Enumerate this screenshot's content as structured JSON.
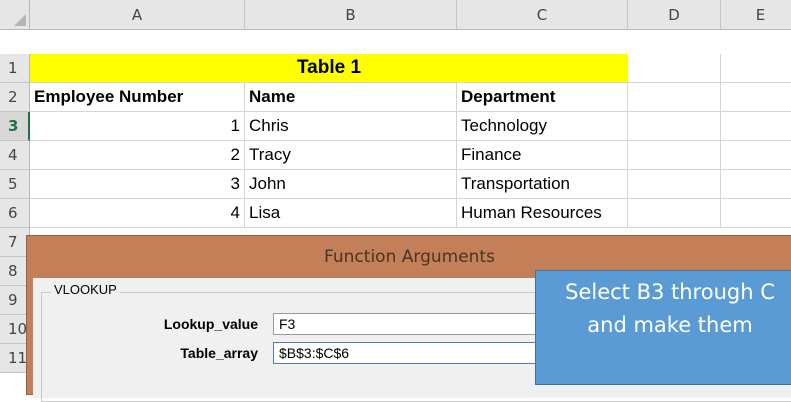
{
  "columns": [
    "A",
    "B",
    "C",
    "D",
    "E"
  ],
  "rows": [
    "1",
    "2",
    "3",
    "4",
    "5",
    "6",
    "7",
    "8",
    "9",
    "10",
    "11"
  ],
  "table_title": "Table 1",
  "headers": {
    "a": "Employee Number",
    "b": "Name",
    "c": "Department"
  },
  "records": [
    {
      "num": "1",
      "name": "Chris",
      "dept": "Technology"
    },
    {
      "num": "2",
      "name": "Tracy",
      "dept": "Finance"
    },
    {
      "num": "3",
      "name": "John",
      "dept": "Transportation"
    },
    {
      "num": "4",
      "name": "Lisa",
      "dept": "Human Resources"
    }
  ],
  "dialog": {
    "title": "Function Arguments",
    "function_name": "VLOOKUP",
    "lookup_label": "Lookup_value",
    "lookup_value": "F3",
    "table_array_label": "Table_array",
    "table_array_value": "$B$3:$C$6"
  },
  "callout": {
    "line1": "Select B3 through C",
    "line2": "and make them"
  },
  "colors": {
    "title_fill": "#ffff00",
    "dialog_frame": "#c27f58",
    "callout_fill": "#5b9bd5",
    "active_row": "#217346"
  }
}
